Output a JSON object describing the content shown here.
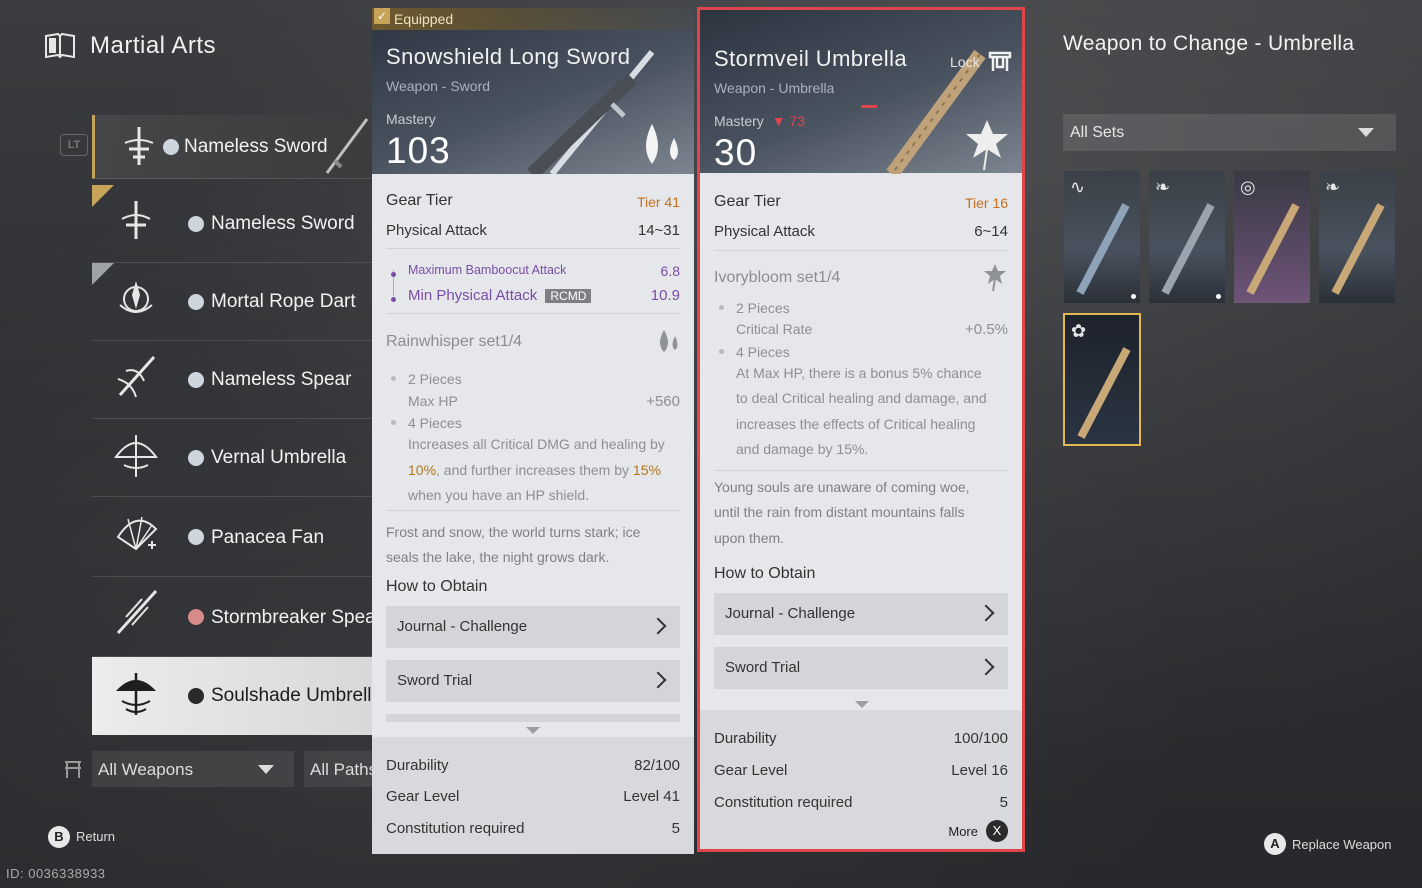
{
  "header": {
    "title": "Martial Arts",
    "lt_badge": "LT"
  },
  "weapon_list": [
    {
      "label": "Nameless Sword",
      "state": "active"
    },
    {
      "label": "Nameless Sword",
      "state": "tagged-gold"
    },
    {
      "label": "Mortal Rope Dart",
      "state": "tagged-gray"
    },
    {
      "label": "Nameless Spear",
      "state": ""
    },
    {
      "label": "Vernal Umbrella",
      "state": ""
    },
    {
      "label": "Panacea Fan",
      "state": ""
    },
    {
      "label": "Stormbreaker Spear",
      "state": ""
    },
    {
      "label": "Soulshade Umbrella",
      "state": "selected"
    }
  ],
  "filters": {
    "weapons": "All Weapons",
    "paths": "All Paths"
  },
  "footer": {
    "return_btn": "B",
    "return_label": "Return",
    "id_text": "ID: 0036338933",
    "replace_btn": "A",
    "replace_label": "Replace Weapon"
  },
  "equipped": {
    "badge": "Equipped",
    "name": "Snowshield Long Sword",
    "subtype": "Weapon - Sword",
    "mastery_label": "Mastery",
    "mastery": "103",
    "gear_tier_label": "Gear Tier",
    "gear_tier": "Tier 41",
    "phys_label": "Physical Attack",
    "phys": "14~31",
    "bonus1_label": "Maximum Bamboocut Attack",
    "bonus1": "6.8",
    "bonus2_label": "Min Physical Attack",
    "bonus2_tag": "RCMD",
    "bonus2": "10.9",
    "set_title": "Rainwhisper set1/4",
    "set_2p": "2 Pieces",
    "set_2p_stat": "Max HP",
    "set_2p_val": "+560",
    "set_4p": "4 Pieces",
    "set_4p_line1": "Increases all Critical DMG and healing by",
    "set_4p_pct1": "10%",
    "set_4p_mid": ", and further increases them by",
    "set_4p_pct2": "15%",
    "set_4p_line3": "when you have an HP shield.",
    "flavor1": "Frost and snow, the world turns stark; ice",
    "flavor2": "seals the lake, the night grows dark.",
    "obtain_title": "How to Obtain",
    "obtain1": "Journal - Challenge",
    "obtain2": "Sword Trial",
    "durability_label": "Durability",
    "durability": "82/100",
    "gear_level_label": "Gear Level",
    "gear_level": "Level 41",
    "constitution_label": "Constitution required",
    "constitution": "5"
  },
  "compare": {
    "name": "Stormveil Umbrella",
    "subtype": "Weapon - Umbrella",
    "lock_label": "Lock",
    "mastery_label": "Mastery",
    "mastery_diff": "73",
    "mastery": "30",
    "gear_tier_label": "Gear Tier",
    "gear_tier": "Tier 16",
    "phys_label": "Physical Attack",
    "phys": "6~14",
    "set_title": "Ivorybloom set1/4",
    "set_2p": "2 Pieces",
    "set_2p_stat": "Critical Rate",
    "set_2p_val": "+0.5%",
    "set_4p": "4 Pieces",
    "set_4p_l1": "At Max HP, there is a bonus 5% chance",
    "set_4p_l2": "to deal Critical healing and damage, and",
    "set_4p_l3": "increases the effects of Critical healing",
    "set_4p_l4": "and damage by 15%.",
    "flavor1": "Young souls are unaware of coming woe,",
    "flavor2": "until the rain from distant mountains falls",
    "flavor3": "upon them.",
    "obtain_title": "How to Obtain",
    "obtain1": "Journal - Challenge",
    "obtain2": "Sword Trial",
    "durability_label": "Durability",
    "durability": "100/100",
    "gear_level_label": "Gear Level",
    "gear_level": "Level 16",
    "constitution_label": "Constitution required",
    "constitution": "5",
    "more_label": "More",
    "more_btn": "X"
  },
  "right_panel": {
    "title": "Weapon to Change - Umbrella",
    "sets_select": "All Sets",
    "thumbs": [
      {
        "icon": "swirl-icon",
        "variant": "steel-blue"
      },
      {
        "icon": "feather-icon",
        "variant": "steel-blue"
      },
      {
        "icon": "spiral-icon",
        "variant": "tan-purple"
      },
      {
        "icon": "feather-icon",
        "variant": "tan"
      },
      {
        "icon": "flower-icon",
        "variant": "tan-selected"
      }
    ]
  },
  "colors": {
    "accent_gold": "#c8a35a",
    "tier": "#c46f22",
    "bonus_purple": "#7a4da6",
    "highlight_red": "#e0454b"
  }
}
